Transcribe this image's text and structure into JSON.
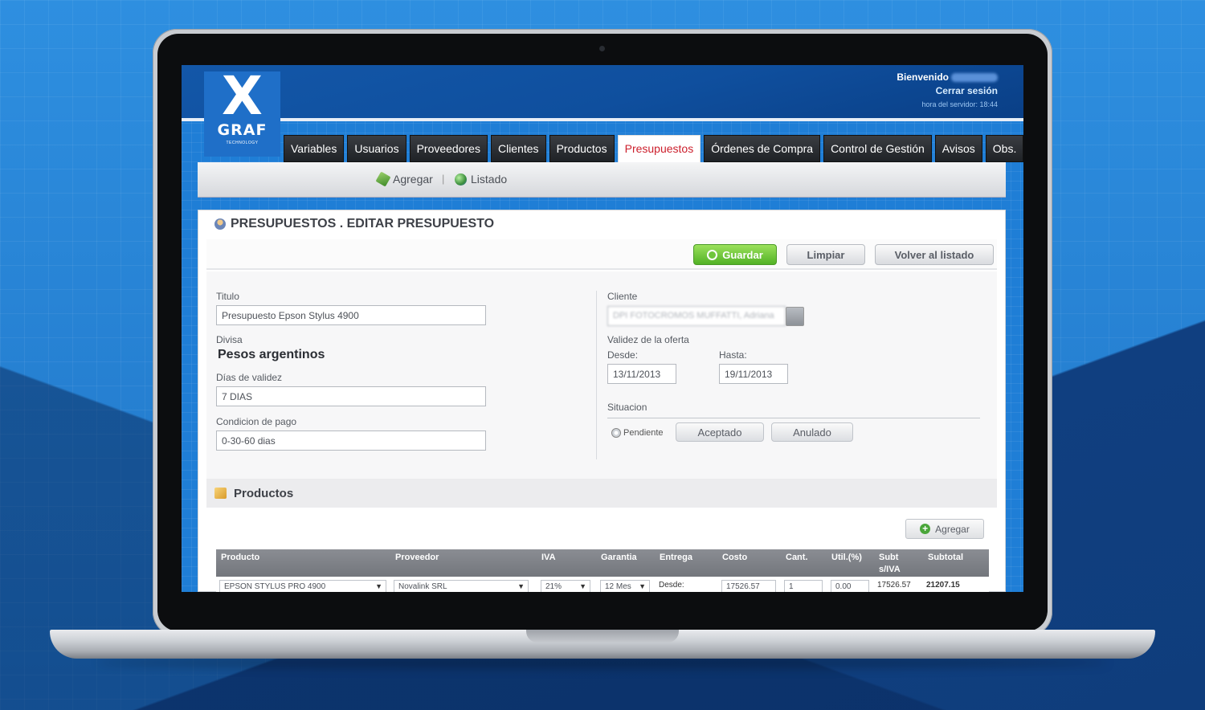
{
  "header": {
    "logo_x": "X",
    "logo_graf": "GRAF",
    "logo_sub": "TECHNOLOGY",
    "welcome": "Bienvenido",
    "logout": "Cerrar sesión",
    "server_time": "hora del servidor: 18:44"
  },
  "tabs": [
    "Variables",
    "Usuarios",
    "Proveedores",
    "Clientes",
    "Productos",
    "Presupuestos",
    "Órdenes de Compra",
    "Control de Gestión",
    "Avisos",
    "Obs."
  ],
  "active_tab": "Presupuestos",
  "subnav": {
    "add": "Agregar",
    "list": "Listado"
  },
  "page": {
    "title": "PRESUPUESTOS . EDITAR PRESUPUESTO",
    "save": "Guardar",
    "clear": "Limpiar",
    "back": "Volver al listado"
  },
  "form": {
    "titulo_label": "Titulo",
    "titulo_value": "Presupuesto Epson Stylus 4900",
    "divisa_label": "Divisa",
    "divisa_value": "Pesos argentinos",
    "dias_label": "Días de validez",
    "dias_value": "7 DIAS",
    "condicion_label": "Condicion de pago",
    "condicion_value": "0-30-60 dias",
    "cliente_label": "Cliente",
    "cliente_value": "DPI FOTOCROMOS MUFFATTI, Adriana",
    "validez_label": "Validez de la oferta",
    "desde_label": "Desde:",
    "desde_value": "13/11/2013",
    "hasta_label": "Hasta:",
    "hasta_value": "19/11/2013",
    "situacion_label": "Situacion",
    "pendiente": "Pendiente",
    "aceptado": "Aceptado",
    "anulado": "Anulado"
  },
  "productos": {
    "title": "Productos",
    "add": "Agregar",
    "columns": [
      "Producto",
      "Proveedor",
      "IVA",
      "Garantia",
      "Entrega",
      "Costo",
      "Cant.",
      "Util.(%)",
      "Subt s/IVA",
      "Subtotal"
    ],
    "row": {
      "producto": "EPSON STYLUS PRO 4900",
      "proveedor": "Novalink SRL",
      "iva": "21%",
      "garantia": "12 Mes",
      "entrega": "Desde:",
      "costo": "17526.57",
      "cant": "1",
      "util": "0.00",
      "subt_siva": "17526.57",
      "subtotal": "21207.15"
    }
  }
}
